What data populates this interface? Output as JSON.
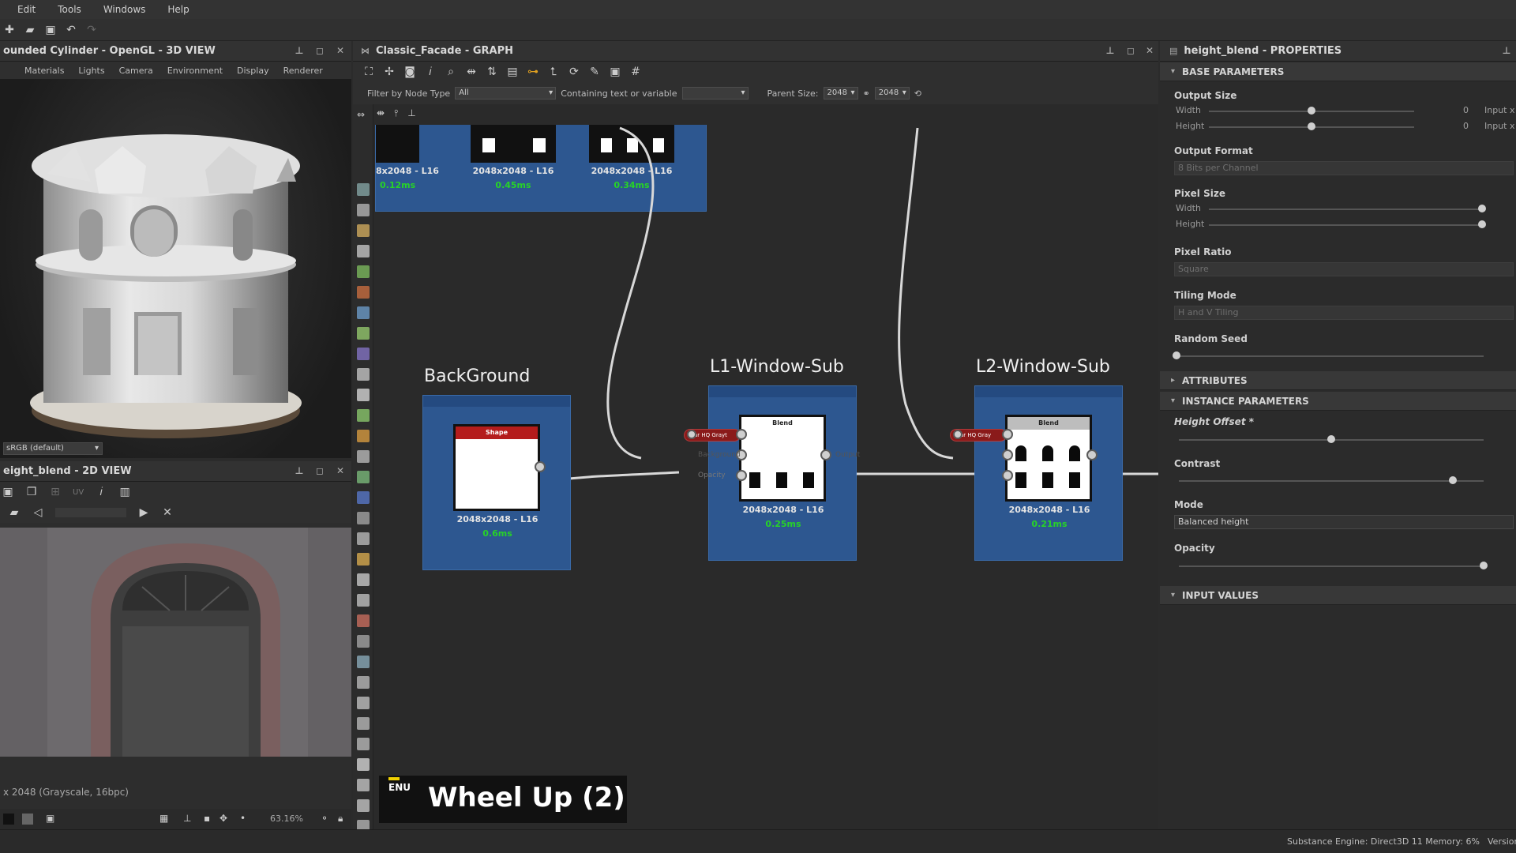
{
  "menu": [
    "Edit",
    "Tools",
    "Windows",
    "Help"
  ],
  "view3d": {
    "title": "ounded Cylinder - OpenGL - 3D VIEW",
    "tabs": [
      "Materials",
      "Lights",
      "Camera",
      "Environment",
      "Display",
      "Renderer"
    ],
    "colorspace": "sRGB (default)"
  },
  "view2d": {
    "title": "eight_blend - 2D VIEW",
    "uv_label": "UV",
    "status": "x 2048 (Grayscale, 16bpc)",
    "zoom": "63.16%"
  },
  "graph": {
    "title": "Classic_Facade - GRAPH",
    "filter_label": "Filter by Node Type",
    "filter_value": "All",
    "contain_label": "Containing text or variable",
    "parent_label": "Parent Size:",
    "parent_value": "2048",
    "size_value": "2048",
    "top_nodes": [
      {
        "size": "8x2048 - L16",
        "time": "0.12ms"
      },
      {
        "size": "2048x2048 - L16",
        "time": "0.45ms"
      },
      {
        "size": "2048x2048 - L16",
        "time": "0.34ms"
      }
    ],
    "frames": [
      {
        "title": "BackGround"
      },
      {
        "title": "L1-Window-Sub"
      },
      {
        "title": "L2-Window-Sub"
      }
    ],
    "shape_node": {
      "header": "Shape",
      "size": "2048x2048 - L16",
      "time": "0.6ms"
    },
    "blend1": {
      "header": "Blend",
      "size": "2048x2048 - L16",
      "time": "0.25ms",
      "pin": "ar HQ Grayt",
      "in_label": "Opacity",
      "in_label2": "Background",
      "out_label": "Output"
    },
    "blend2": {
      "header": "Blend",
      "size": "2048x2048 - L16",
      "time": "0.21ms",
      "pin": "ar HQ Gray"
    },
    "overlay": {
      "lang": "ENU",
      "text": "Wheel Up (2)"
    }
  },
  "props": {
    "title": "height_blend - PROPERTIES",
    "sections": {
      "base": "BASE PARAMETERS",
      "attributes": "ATTRIBUTES",
      "instance": "INSTANCE PARAMETERS",
      "input": "INPUT VALUES"
    },
    "output_size": {
      "label": "Output Size",
      "w": "Width",
      "h": "Height",
      "wval": "0",
      "hval": "0",
      "wsuffix": "Input x",
      "hsuffix": "Input x"
    },
    "output_format": {
      "label": "Output Format",
      "value": "8 Bits per Channel"
    },
    "pixel_size": {
      "label": "Pixel Size",
      "w": "Width",
      "h": "Height"
    },
    "pixel_ratio": {
      "label": "Pixel Ratio",
      "value": "Square"
    },
    "tiling_mode": {
      "label": "Tiling Mode",
      "value": "H and V Tiling"
    },
    "random_seed": {
      "label": "Random Seed"
    },
    "height_offset": {
      "label": "Height Offset *",
      "value": 0.5
    },
    "contrast": {
      "label": "Contrast",
      "value": 0.9
    },
    "mode": {
      "label": "Mode",
      "value": "Balanced height"
    },
    "opacity": {
      "label": "Opacity",
      "value": 1.0
    }
  },
  "status": {
    "engine": "Substance Engine: Direct3D 11  Memory: 6%",
    "version": "Version"
  }
}
